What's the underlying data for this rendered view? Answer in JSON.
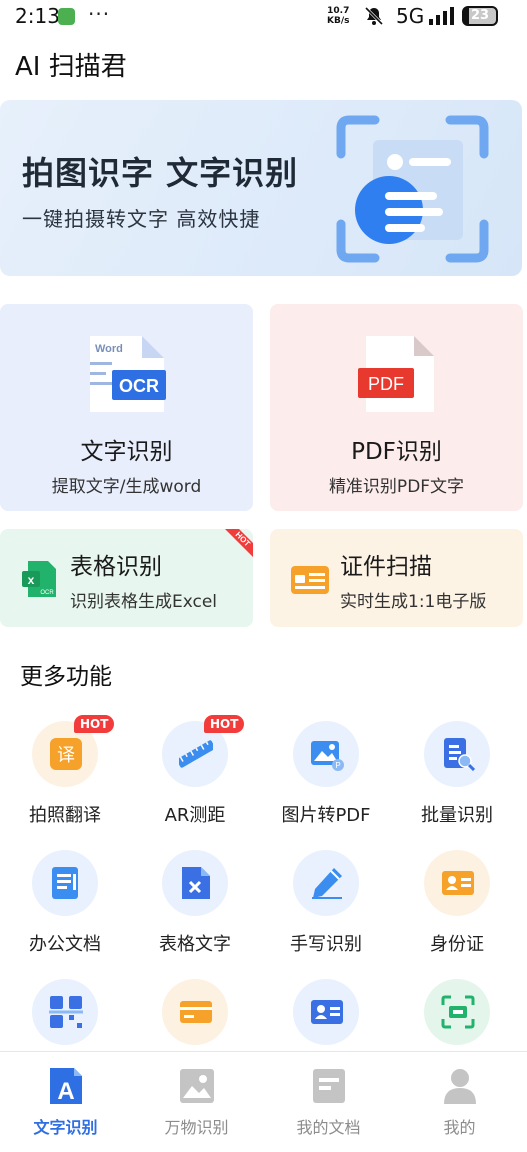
{
  "status_bar": {
    "time": "2:13",
    "more": "···",
    "speed_value": "10.7",
    "speed_unit": "KB/s",
    "network": "5G",
    "battery": "23"
  },
  "app_title": "AI 扫描君",
  "banner": {
    "title": "拍图识字  文字识别",
    "subtitle": "一键拍摄转文字  高效快捷"
  },
  "feature_cards": {
    "ocr": {
      "icon_word": "Word",
      "icon_label": "OCR",
      "title": "文字识别",
      "subtitle": "提取文字/生成word"
    },
    "pdf": {
      "icon_label": "PDF",
      "title": "PDF识别",
      "subtitle": "精准识别PDF文字"
    },
    "table": {
      "icon_label": "OCR",
      "title": "表格识别",
      "subtitle": "识别表格生成Excel",
      "badge": "HOT"
    },
    "cert": {
      "title": "证件扫描",
      "subtitle": "实时生成1:1电子版"
    }
  },
  "more_section": {
    "title": "更多功能",
    "items": [
      {
        "label": "拍照翻译",
        "icon": "translate-icon",
        "badge": "HOT",
        "glyph": "译"
      },
      {
        "label": "AR测距",
        "icon": "ruler-icon",
        "badge": "HOT"
      },
      {
        "label": "图片转PDF",
        "icon": "image-pdf-icon"
      },
      {
        "label": "批量识别",
        "icon": "batch-scan-icon"
      },
      {
        "label": "办公文档",
        "icon": "office-doc-icon"
      },
      {
        "label": "表格文字",
        "icon": "table-doc-icon"
      },
      {
        "label": "手写识别",
        "icon": "pen-icon"
      },
      {
        "label": "身份证",
        "icon": "id-card-icon"
      },
      {
        "label": "",
        "icon": "qr-code-icon"
      },
      {
        "label": "",
        "icon": "bank-card-icon"
      },
      {
        "label": "",
        "icon": "business-card-icon"
      },
      {
        "label": "",
        "icon": "scan-frame-icon"
      }
    ]
  },
  "tabbar": {
    "tabs": [
      {
        "label": "文字识别",
        "active": true,
        "glyph": "A"
      },
      {
        "label": "万物识别"
      },
      {
        "label": "我的文档"
      },
      {
        "label": "我的"
      }
    ]
  },
  "colors": {
    "accent_blue": "#2f6fe4",
    "hot_red": "#f23b3b",
    "pdf_red": "#e8392f",
    "green": "#21b36b",
    "orange": "#f5a12a"
  }
}
